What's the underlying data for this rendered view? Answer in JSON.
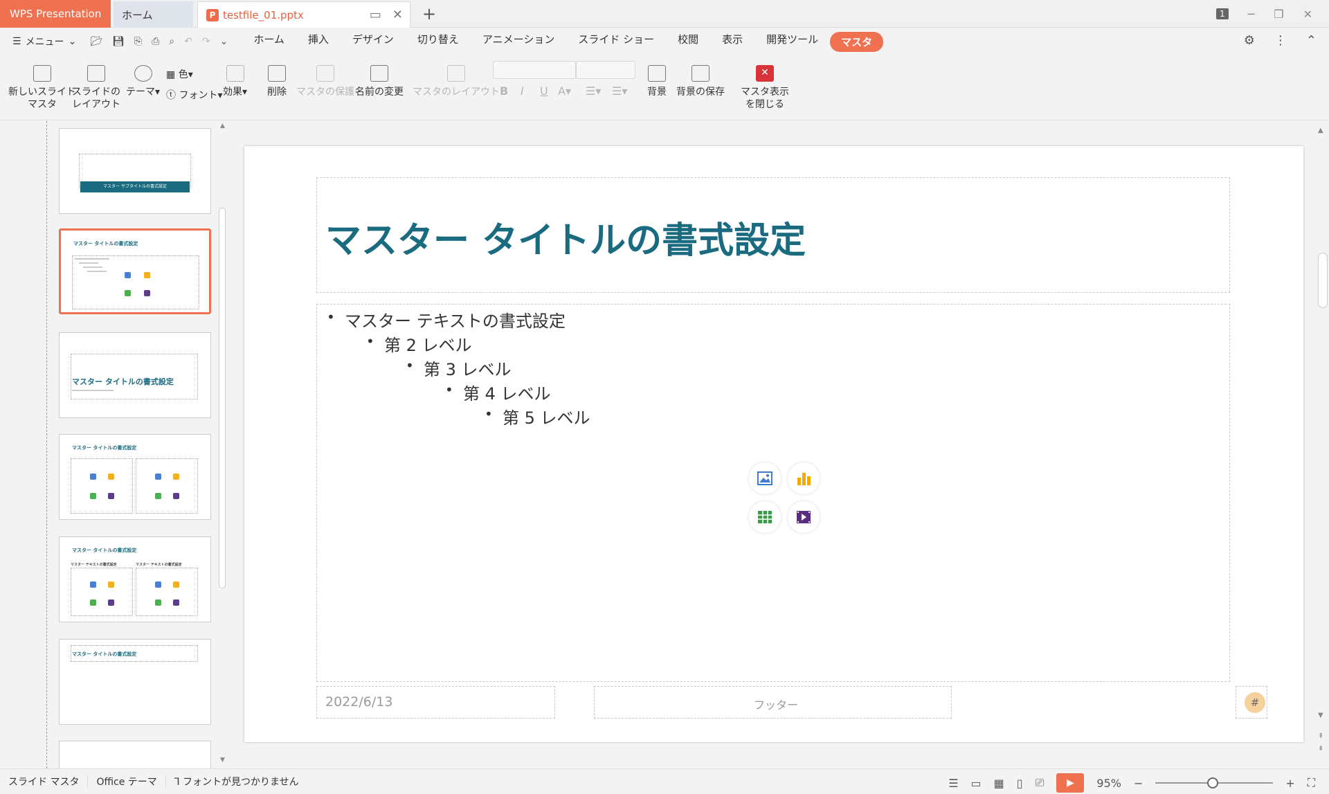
{
  "titlebar": {
    "app_tab": "WPS Presentation",
    "home_tab": "ホーム",
    "file_tab": "testfile_01.pptx",
    "file_icon": "P",
    "new_tab": "+",
    "window_badge": "1"
  },
  "menurow": {
    "menu_label": "メニュー",
    "tabs": [
      "ホーム",
      "挿入",
      "デザイン",
      "切り替え",
      "アニメーション",
      "スライド ショー",
      "校閲",
      "表示",
      "開発ツール",
      "マスタ"
    ],
    "active_tab": "マスタ"
  },
  "ribbon": {
    "new_master_l1": "新しいスライド",
    "new_master_l2": "マスタ",
    "slide_layout_l1": "スライドの",
    "slide_layout_l2": "レイアウト",
    "theme": "テーマ",
    "color": "色",
    "font": "フォント",
    "effect": "効果",
    "delete": "削除",
    "protect_master": "マスタの保護",
    "rename": "名前の変更",
    "master_layout": "マスタのレイアウト",
    "background": "背景",
    "save_background": "背景の保存",
    "close_master_l1": "マスタ表示",
    "close_master_l2": "を閉じる"
  },
  "thumbs": {
    "t1_title": "マスター サブタイトルの書式設定",
    "t2_title": "マスター タイトルの書式設定",
    "t3_title": "マスター タイトルの書式設定",
    "t4_title": "マスター タイトルの書式設定",
    "t5_title": "マスター タイトルの書式設定",
    "t5_sub_left": "マスター テキストの書式設定",
    "t5_sub_right": "マスター テキストの書式設定",
    "t6_title": "マスター タイトルの書式設定"
  },
  "slide": {
    "title": "マスター タイトルの書式設定",
    "bullets": [
      "マスター テキストの書式設定",
      "第 2 レベル",
      "第 3 レベル",
      "第 4 レベル",
      "第 5 レベル"
    ],
    "date": "2022/6/13",
    "footer": "フッター",
    "page_num": "#"
  },
  "statusbar": {
    "mode": "スライド マスタ",
    "theme": "Office テーマ",
    "font_warning": "フォントが見つかりません",
    "zoom": "95%"
  },
  "colors": {
    "accent": "#ef7150",
    "title_teal": "#1a6b7f"
  }
}
